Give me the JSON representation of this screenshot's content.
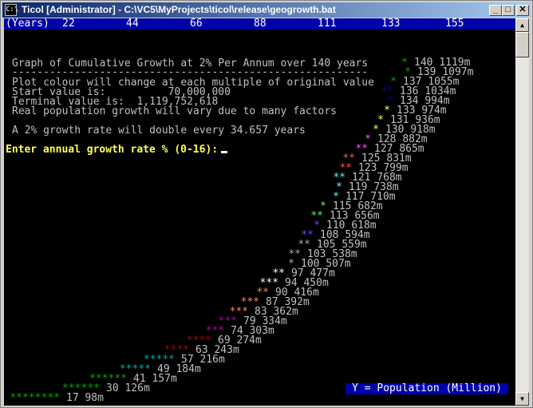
{
  "window": {
    "title": "Ticol  [Administrator] - C:\\VC5\\MyProjects\\ticol\\release\\geogrowth.bat",
    "minimize_glyph": "_",
    "maximize_glyph": "□",
    "close_glyph": "✕"
  },
  "ruler": {
    "label": "(Years)",
    "ticks": [
      "22",
      "44",
      "66",
      "88",
      "111",
      "133",
      "155"
    ]
  },
  "info": {
    "heading": "Graph of Cumulative Growth at 2% Per Annum over 140 years",
    "rule": "---------------------------------------------------------",
    "line1": "Plot colour will change at each multiple of original value",
    "line2": "Start value is:          70,000,000",
    "line3": "Terminal value is:  1,119,752,618",
    "line4": "Real population growth will vary due to many factors",
    "line5": "A 2% growth rate will double every 34.657 years"
  },
  "prompt": "Enter annual growth rate % (0-16):",
  "y_axis_label": "Y = Population (Million)",
  "colors": {
    "blue_bar": "#0000a8",
    "prompt": "#ffff55",
    "text": "#c0c0c0"
  },
  "plot": [
    {
      "stars": "*",
      "year": "140",
      "value": "1119m",
      "color": "#00aa00"
    },
    {
      "stars": "*",
      "year": "139",
      "value": "1097m",
      "color": "#00aa00"
    },
    {
      "stars": "*",
      "year": "137",
      "value": "1055m",
      "color": "#00aa00"
    },
    {
      "stars": "**",
      "year": "136",
      "value": "1034m",
      "color": "#0000aa"
    },
    {
      "stars": "*",
      "year": "134",
      "value": "994m",
      "color": "#0000aa"
    },
    {
      "stars": "*",
      "year": "133",
      "value": "974m",
      "color": "#ffff55"
    },
    {
      "stars": "*",
      "year": "131",
      "value": "936m",
      "color": "#ffff55"
    },
    {
      "stars": "*",
      "year": "130",
      "value": "918m",
      "color": "#ffff55"
    },
    {
      "stars": "*",
      "year": "128",
      "value": "882m",
      "color": "#ff55ff"
    },
    {
      "stars": "**",
      "year": "127",
      "value": "865m",
      "color": "#ff55ff"
    },
    {
      "stars": "**",
      "year": "125",
      "value": "831m",
      "color": "#ff5555"
    },
    {
      "stars": "**",
      "year": "123",
      "value": "799m",
      "color": "#ff5555"
    },
    {
      "stars": "**",
      "year": "121",
      "value": "768m",
      "color": "#55ffff"
    },
    {
      "stars": "*",
      "year": "119",
      "value": "738m",
      "color": "#55ffff"
    },
    {
      "stars": "*",
      "year": "117",
      "value": "710m",
      "color": "#55ffff"
    },
    {
      "stars": "*",
      "year": "115",
      "value": "682m",
      "color": "#55ff55"
    },
    {
      "stars": "**",
      "year": "113",
      "value": "656m",
      "color": "#55ff55"
    },
    {
      "stars": "*",
      "year": "110",
      "value": "618m",
      "color": "#5555ff"
    },
    {
      "stars": "**",
      "year": "108",
      "value": "594m",
      "color": "#5555ff"
    },
    {
      "stars": "**",
      "year": "105",
      "value": "559m",
      "color": "#aaaaaa"
    },
    {
      "stars": "**",
      "year": "103",
      "value": "538m",
      "color": "#aaaaaa"
    },
    {
      "stars": "*",
      "year": "100",
      "value": "507m",
      "color": "#aaaaaa"
    },
    {
      "stars": "**",
      "year": "97",
      "value": "477m",
      "color": "#ffffff"
    },
    {
      "stars": "***",
      "year": "94",
      "value": "450m",
      "color": "#ffffff"
    },
    {
      "stars": "**",
      "year": "90",
      "value": "416m",
      "color": "#ff8855"
    },
    {
      "stars": "***",
      "year": "87",
      "value": "392m",
      "color": "#ff8855"
    },
    {
      "stars": "***",
      "year": "83",
      "value": "362m",
      "color": "#ff8855"
    },
    {
      "stars": "***",
      "year": "79",
      "value": "334m",
      "color": "#aa00aa"
    },
    {
      "stars": "***",
      "year": "74",
      "value": "303m",
      "color": "#aa00aa"
    },
    {
      "stars": "****",
      "year": "69",
      "value": "274m",
      "color": "#aa0000"
    },
    {
      "stars": "****",
      "year": "63",
      "value": "243m",
      "color": "#aa0000"
    },
    {
      "stars": "*****",
      "year": "57",
      "value": "216m",
      "color": "#00aaaa"
    },
    {
      "stars": "*****",
      "year": "49",
      "value": "184m",
      "color": "#00aaaa"
    },
    {
      "stars": "******",
      "year": "41",
      "value": "157m",
      "color": "#00aa00"
    },
    {
      "stars": "******",
      "year": "30",
      "value": "126m",
      "color": "#00aa00"
    },
    {
      "stars": "********",
      "year": "17",
      "value": "98m",
      "color": "#00aa00"
    }
  ]
}
